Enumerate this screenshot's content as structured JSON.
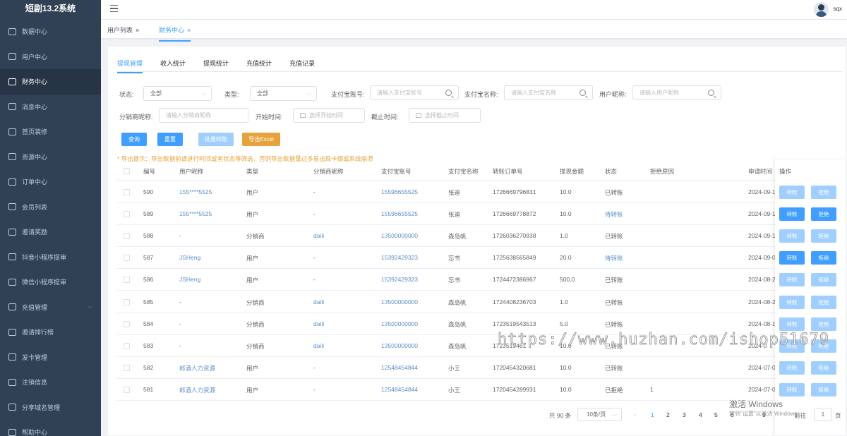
{
  "app_title": "短剧13.2系统",
  "sidebar": {
    "items": [
      {
        "label": "数据中心"
      },
      {
        "label": "用户中心"
      },
      {
        "label": "财务中心",
        "active": true
      },
      {
        "label": "消息中心"
      },
      {
        "label": "首页装修"
      },
      {
        "label": "资源中心"
      },
      {
        "label": "订单中心"
      },
      {
        "label": "会员列表"
      },
      {
        "label": "邀请奖励"
      },
      {
        "label": "抖音小程序提审"
      },
      {
        "label": "微信小程序提审"
      },
      {
        "label": "充值管理",
        "has_children": true
      },
      {
        "label": "邀请排行榜"
      },
      {
        "label": "发卡管理"
      },
      {
        "label": "注销信息"
      },
      {
        "label": "分享域名管理"
      },
      {
        "label": "帮助中心"
      }
    ]
  },
  "header": {
    "username": "sqx"
  },
  "tagsview": [
    {
      "label": "用户列表",
      "close": "×"
    },
    {
      "label": "财务中心",
      "close": "×",
      "active": true
    }
  ],
  "tabs": [
    "提现管理",
    "收入统计",
    "提现统计",
    "充值统计",
    "充值记录"
  ],
  "filters": {
    "status_label": "状态:",
    "status_value": "全部",
    "type_label": "类型:",
    "type_value": "全部",
    "alipay_account_label": "支付宝账号:",
    "alipay_account_placeholder": "请输入支付宝账号",
    "alipay_name_label": "支付宝名称:",
    "alipay_name_placeholder": "请输入支付宝名称",
    "nickname_label": "用户昵称:",
    "nickname_placeholder": "请输入用户昵称",
    "distributor_label": "分销商昵称:",
    "distributor_placeholder": "请输入分销商昵称",
    "start_label": "开始时间:",
    "start_placeholder": "选择开始时间",
    "end_label": "截止时间:",
    "end_placeholder": "选择截止时间"
  },
  "buttons": {
    "query": "查询",
    "reset": "重置",
    "batch_transfer": "批量转账",
    "export": "导出Excel"
  },
  "export_tip": "* 导出提示：导出数据前请进行时间或者状态等筛选，否则导出数据量过多易出现卡顿或系统崩溃",
  "table": {
    "columns": [
      "编号",
      "用户昵称",
      "类型",
      "分销商昵称",
      "支付宝账号",
      "支付宝名称",
      "转账订单号",
      "提现金额",
      "状态",
      "拒绝原因",
      "申请时间",
      "操作"
    ],
    "rows": [
      {
        "id": "590",
        "nickname": "155****5525",
        "type": "用户",
        "distributor": "-",
        "account": "15596655525",
        "name": "张迪",
        "order": "1726669796831",
        "amount": "10.0",
        "status": "已转账",
        "reason": "",
        "time": "2024-09-1",
        "pending": false
      },
      {
        "id": "589",
        "nickname": "155****5525",
        "type": "用户",
        "distributor": "-",
        "account": "15596655525",
        "name": "张迪",
        "order": "1726669778872",
        "amount": "10.0",
        "status": "待转账",
        "reason": "",
        "time": "2024-09-1",
        "pending": true
      },
      {
        "id": "588",
        "nickname": "-",
        "type": "分销商",
        "distributor": "daili",
        "account": "13500000000",
        "name": "森岛帆",
        "order": "1726036270938",
        "amount": "1.0",
        "status": "已转账",
        "reason": "",
        "time": "2024-09-1",
        "pending": false
      },
      {
        "id": "587",
        "nickname": "JSHeng",
        "type": "用户",
        "distributor": "-",
        "account": "15392429323",
        "name": "忘书",
        "order": "1725638565849",
        "amount": "20.0",
        "status": "待转账",
        "reason": "",
        "time": "2024-09-0",
        "pending": true
      },
      {
        "id": "586",
        "nickname": "JSHeng",
        "type": "用户",
        "distributor": "-",
        "account": "15392429323",
        "name": "忘书",
        "order": "1724472386967",
        "amount": "500.0",
        "status": "已转账",
        "reason": "",
        "time": "2024-08-2",
        "pending": false
      },
      {
        "id": "585",
        "nickname": "-",
        "type": "分销商",
        "distributor": "daili",
        "account": "13500000000",
        "name": "森岛帆",
        "order": "1724408236703",
        "amount": "1.0",
        "status": "已转账",
        "reason": "",
        "time": "2024-08-2",
        "pending": false
      },
      {
        "id": "584",
        "nickname": "-",
        "type": "分销商",
        "distributor": "daili",
        "account": "13500000000",
        "name": "森岛帆",
        "order": "1723519543513",
        "amount": "5.0",
        "status": "已转账",
        "reason": "",
        "time": "2024-08-1",
        "pending": false
      },
      {
        "id": "583",
        "nickname": "-",
        "type": "分销商",
        "distributor": "daili",
        "account": "13500000000",
        "name": "森岛帆",
        "order": "1723519461",
        "amount": "10.0",
        "status": "已转账",
        "reason": "",
        "time": "2024-0",
        "pending": false
      },
      {
        "id": "582",
        "nickname": "郎酒人力资源",
        "type": "用户",
        "distributor": "-",
        "account": "12548454844",
        "name": "小王",
        "order": "1720454320681",
        "amount": "10.0",
        "status": "已转账",
        "reason": "",
        "time": "2024-07-0",
        "pending": false
      },
      {
        "id": "581",
        "nickname": "郎酒人力资源",
        "type": "用户",
        "distributor": "-",
        "account": "12548454844",
        "name": "小王",
        "order": "1720454289931",
        "amount": "10.0",
        "status": "已拒绝",
        "reason": "1",
        "time": "2024-07-0",
        "pending": false
      }
    ],
    "op_transfer": "转账",
    "op_reject": "拒绝"
  },
  "pagination": {
    "total": "共 90 条",
    "page_size": "10条/页",
    "prev": "‹",
    "pages": [
      "1",
      "2",
      "3",
      "4",
      "5",
      "6",
      "···",
      "9"
    ],
    "current": "1",
    "goto_label": "前往",
    "goto_value": "1",
    "goto_suffix": "页"
  },
  "overlay": {
    "watermark": "https://www.huzhan.com/ishop51679",
    "windows_activate": "激活 Windows",
    "windows_hint": "转到\"设置\"以激活 Windows。"
  },
  "colors": {
    "sidebar_bg": "#304156",
    "primary": "#409eff",
    "primary_disabled": "#a0cfff",
    "warning": "#e6a23c"
  }
}
